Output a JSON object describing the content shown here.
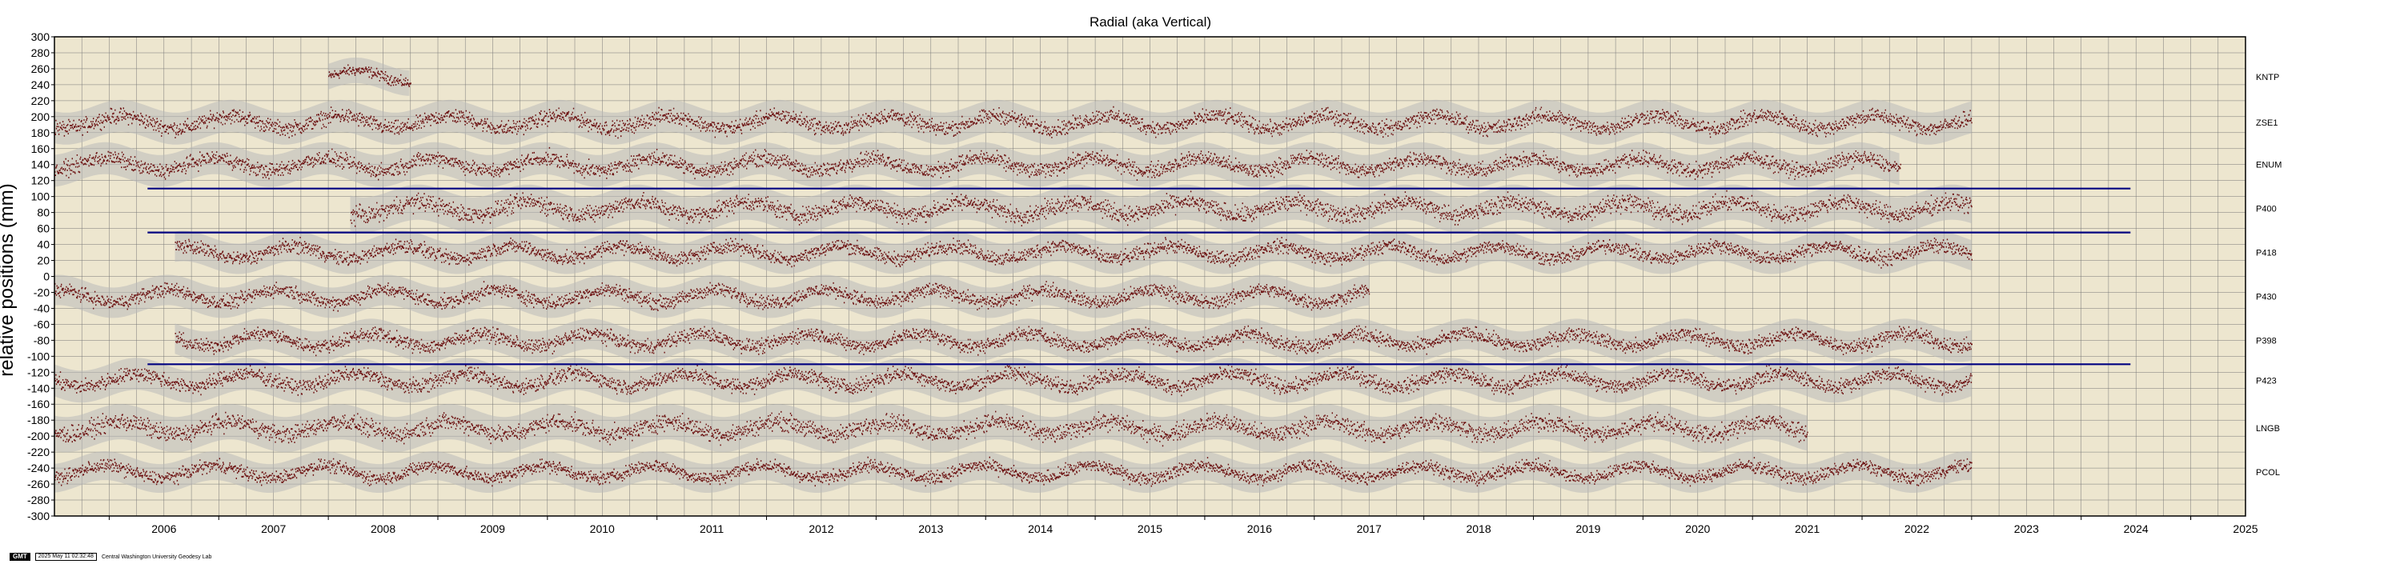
{
  "chart_data": {
    "type": "scatter",
    "title": "Radial (aka Vertical)",
    "ylabel": "relative positions (mm)",
    "xlabel": "",
    "xlim": [
      2005.5,
      2025.5
    ],
    "ylim": [
      -300,
      300
    ],
    "y_ticks": [
      300,
      280,
      260,
      240,
      220,
      200,
      180,
      160,
      140,
      120,
      100,
      80,
      60,
      40,
      20,
      0,
      -20,
      -40,
      -60,
      -80,
      -100,
      -120,
      -140,
      -160,
      -180,
      -200,
      -220,
      -240,
      -260,
      -280,
      -300
    ],
    "x_ticks": [
      "2006",
      "2007",
      "2008",
      "2009",
      "2010",
      "2011",
      "2012",
      "2013",
      "2014",
      "2015",
      "2016",
      "2017",
      "2018",
      "2019",
      "2020",
      "2021",
      "2022",
      "2023",
      "2024",
      "2025"
    ],
    "grid": true,
    "background_color": "#ede6cf",
    "point_color": "#6b0f0f",
    "error_band_color": "#b9b9b9",
    "reference_line_color": "#000080",
    "series": [
      {
        "name": "KNTP",
        "offset": 250,
        "start": 2008.0,
        "end": 2008.75,
        "spread": 10
      },
      {
        "name": "ZSE1",
        "offset": 193,
        "start": 2005.5,
        "end": 2023.0,
        "spread": 14
      },
      {
        "name": "ENUM",
        "offset": 140,
        "start": 2005.5,
        "end": 2022.35,
        "spread": 14
      },
      {
        "name": "P400",
        "offset": 85,
        "start": 2008.2,
        "end": 2023.0,
        "spread": 16
      },
      {
        "name": "P418",
        "offset": 30,
        "start": 2006.6,
        "end": 2023.0,
        "spread": 13
      },
      {
        "name": "P430",
        "offset": -25,
        "start": 2005.5,
        "end": 2017.5,
        "spread": 13
      },
      {
        "name": "P398",
        "offset": -80,
        "start": 2006.6,
        "end": 2023.0,
        "spread": 13
      },
      {
        "name": "P423",
        "offset": -130,
        "start": 2005.5,
        "end": 2023.0,
        "spread": 14
      },
      {
        "name": "LNGB",
        "offset": -190,
        "start": 2005.5,
        "end": 2021.5,
        "spread": 16
      },
      {
        "name": "PCOL",
        "offset": -245,
        "start": 2005.5,
        "end": 2023.0,
        "spread": 12
      }
    ],
    "reference_lines": [
      {
        "y": 110,
        "x_start": 2006.35,
        "x_end": 2024.45
      },
      {
        "y": 55,
        "x_start": 2006.35,
        "x_end": 2024.45
      },
      {
        "y": -110,
        "x_start": 2006.35,
        "x_end": 2024.45
      }
    ]
  },
  "footer": {
    "badge": "GMT",
    "timestamp": "2025 May 11 02:32:48",
    "credit": "Central Washington University Geodesy Lab"
  }
}
